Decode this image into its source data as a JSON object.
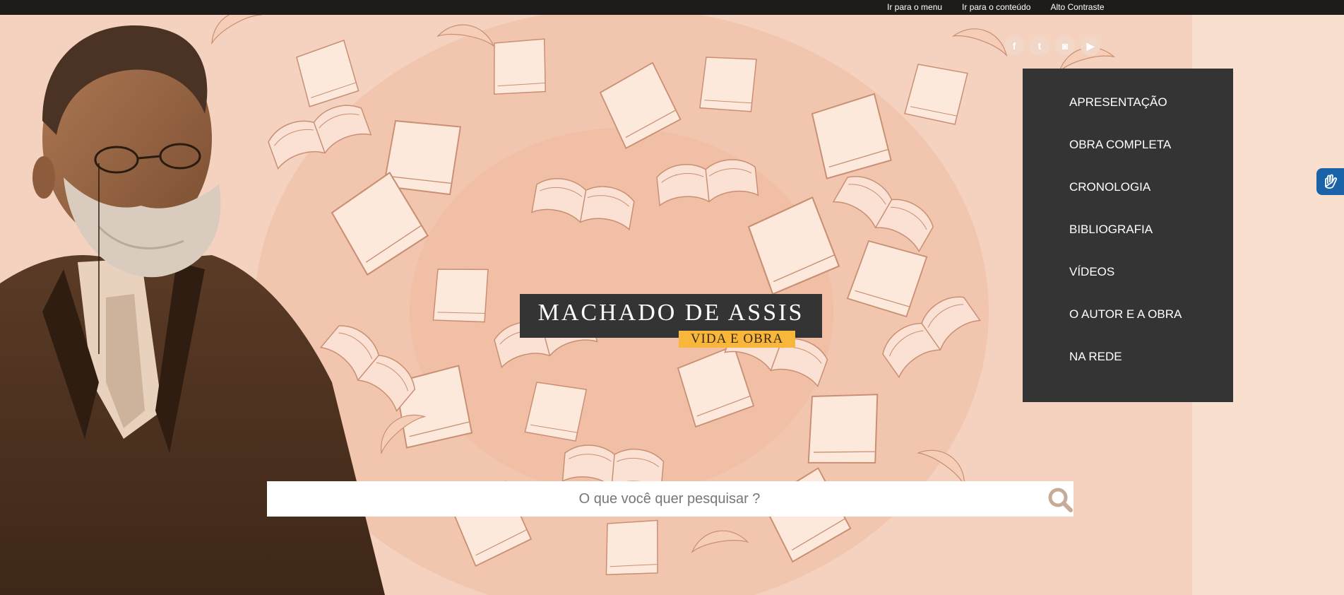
{
  "topbar": {
    "links": [
      "Ir para o menu",
      "Ir para o conteúdo",
      "Alto Contraste"
    ]
  },
  "social": {
    "icons": [
      "facebook-icon",
      "twitter-icon",
      "instagram-icon",
      "youtube-icon"
    ]
  },
  "menu": {
    "items": [
      "APRESENTAÇÃO",
      "OBRA COMPLETA",
      "CRONOLOGIA",
      "BIBLIOGRAFIA",
      "VÍDEOS",
      "O AUTOR E A OBRA",
      "NA REDE"
    ]
  },
  "logo": {
    "title": "MACHADO DE ASSIS",
    "subtitle": "VIDA E OBRA"
  },
  "search": {
    "placeholder": "O que você quer pesquisar ?",
    "icon": "search-icon"
  },
  "accessibility": {
    "icon": "sign-language-icon"
  },
  "colors": {
    "topbar": "#1f1b1b",
    "menu": "#343434",
    "accent": "#f8b73b",
    "background": "#f7dccb",
    "accessibility": "#1a63a8"
  }
}
